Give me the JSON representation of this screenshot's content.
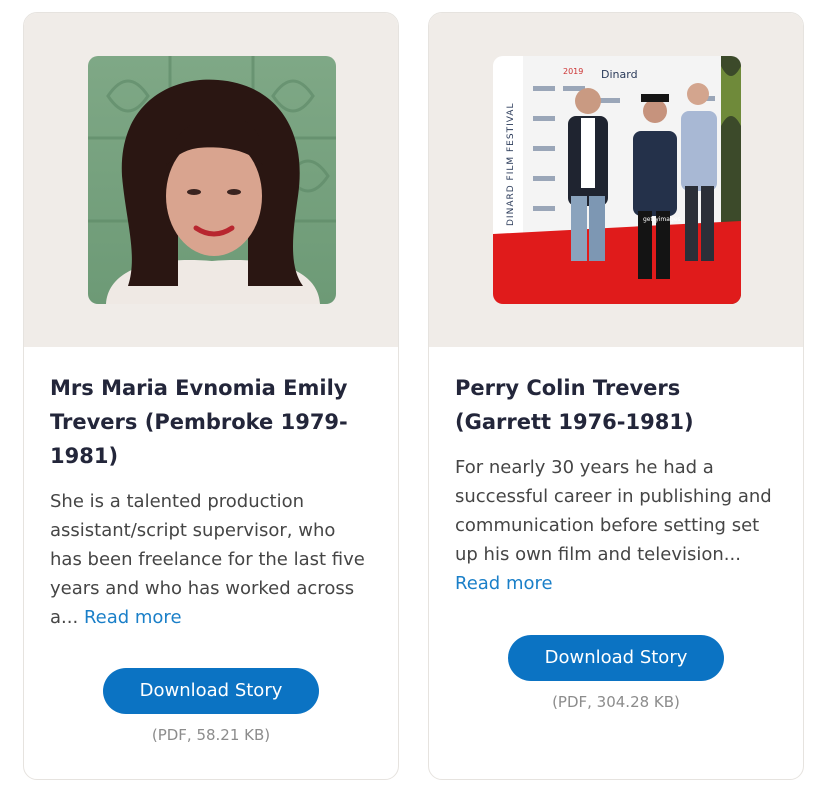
{
  "cards": [
    {
      "name": "Mrs Maria Evnomia Emily Trevers (Pembroke 1979-1981)",
      "excerpt": "She is a talented production assistant/script supervisor, who has been freelance for the last five years and who has worked across a...",
      "read_more_label": "Read more",
      "download_label": "Download Story",
      "file_info": "(PDF, 58.21 KB)"
    },
    {
      "name": "Perry Colin Trevers (Garrett 1976-1981)",
      "excerpt": "For nearly 30 years he had a successful career in publishing and communication before setting set up his own film and television...",
      "read_more_label": "Read more",
      "download_label": "Download Story",
      "file_info": "(PDF, 304.28 KB)",
      "photo_text": {
        "festival": "DINARD FILM FESTIVAL",
        "brand": "Dinard",
        "year": "2019",
        "watermark": "gettyimages"
      }
    }
  ],
  "colors": {
    "button": "#0b73c3",
    "link": "#1a7fc8",
    "photo_background": "#f0ece8",
    "heading": "#23263a"
  }
}
